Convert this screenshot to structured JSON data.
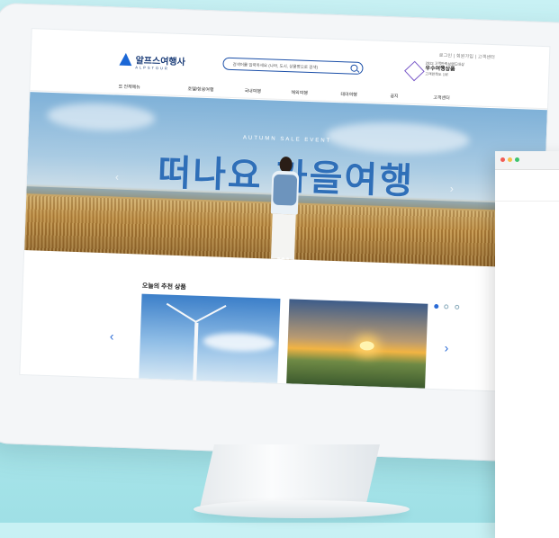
{
  "header": {
    "utility_links": "로그인 | 회원가입 | 고객센터",
    "logo_text": "알프스여행사",
    "logo_sub": "ALPSTOUR",
    "search_placeholder": "검색어를 입력하세요 (나라, 도시, 상품명으로 검색)",
    "award_line1": "2023 고객만족브랜드대상",
    "award_line2": "우수여행상품",
    "award_line3": "고객만족도 1위"
  },
  "nav": {
    "items": [
      "☰ 전체메뉴",
      "호텔/항공여행",
      "국내여행",
      "해외여행",
      "테마여행",
      "공지",
      "고객센터"
    ]
  },
  "hero": {
    "event_label": "AUTUMN SALE EVENT",
    "headline": "떠나요 가을여행"
  },
  "recommend": {
    "title": "오늘의 추천 상품"
  },
  "colors": {
    "accent": "#1b67d6",
    "headline": "#2f6fb8"
  }
}
